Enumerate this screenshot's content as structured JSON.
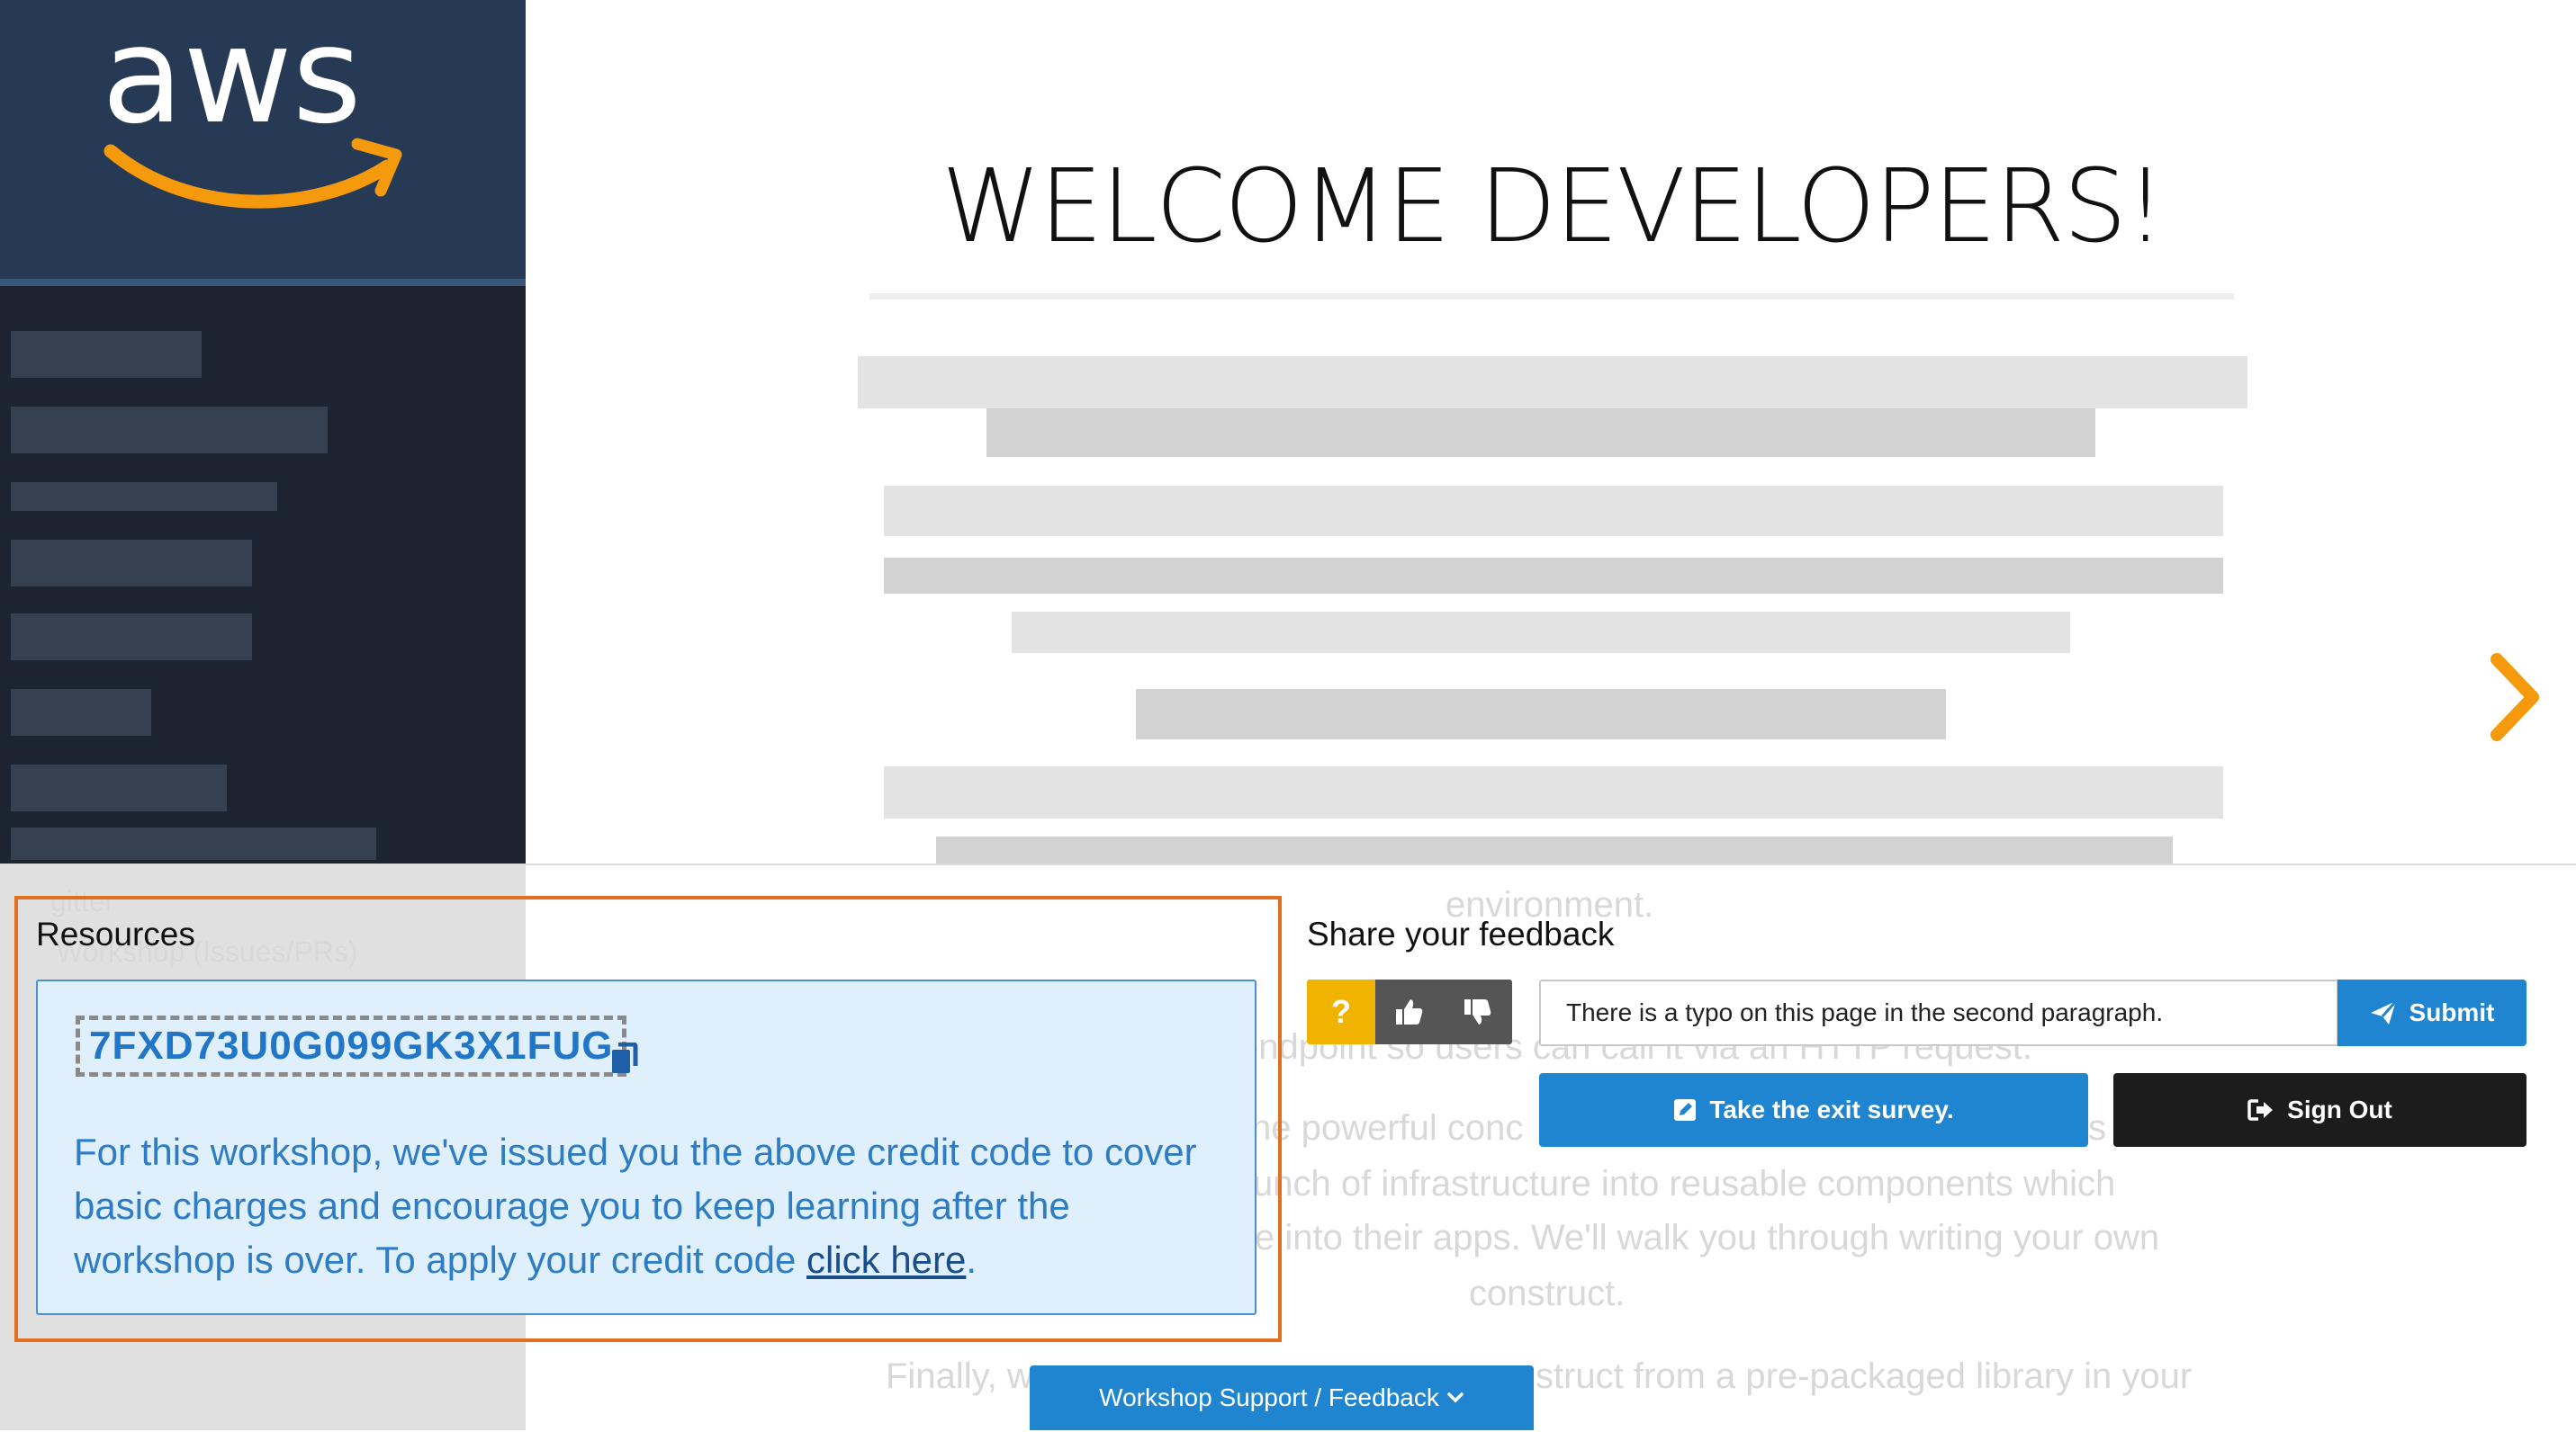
{
  "header": {
    "logo_text": "aws",
    "page_title": "WELCOME DEVELOPERS!"
  },
  "sidebar": {
    "ghost_items": [
      "gitter",
      "Workshop (Issues/PRs)"
    ]
  },
  "background_text": {
    "lines": [
      "environment.",
      "endpoint so users can call it via an HTTP request.",
      "he powerful conc",
      "s",
      "unch of infrastructure into reusable components which",
      "e into their apps. We'll walk you through writing your own",
      "construct.",
      "Finally, w",
      "struct from a pre-packaged library in your"
    ]
  },
  "resources": {
    "title": "Resources",
    "credit_code": "7FXD73U0G099GK3X1FUG",
    "description": "For this workshop, we've issued you the above credit code to cover basic charges and encourage you to keep learning after the workshop is over. To apply your credit code ",
    "link_text": "click here",
    "trailing": "."
  },
  "feedback": {
    "title": "Share your feedback",
    "question_label": "?",
    "input_value": "There is a typo on this page in the second paragraph.",
    "submit_label": "Submit",
    "exit_survey_label": "Take the exit survey.",
    "sign_out_label": "Sign Out"
  },
  "support_tab": {
    "label": "Workshop Support / Feedback"
  },
  "colors": {
    "accent": "#1f85d1",
    "aws_orange": "#f59a0c",
    "highlight_outline": "#e07020",
    "question": "#f0b400"
  },
  "icons": [
    "copy-icon",
    "thumbs-up-icon",
    "thumbs-down-icon",
    "send-icon",
    "edit-icon",
    "sign-out-icon",
    "chevron-down-icon",
    "chevron-right-icon"
  ]
}
